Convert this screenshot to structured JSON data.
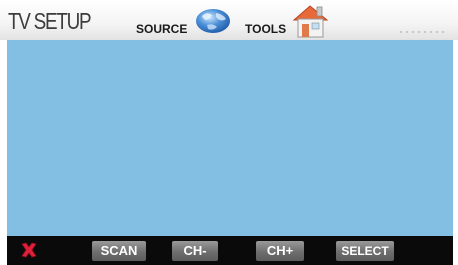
{
  "header": {
    "title": "TV SETUP",
    "source_label": "SOURCE",
    "tools_label": "TOOLS",
    "source_icon": "globe-icon",
    "tools_icon": "home-icon"
  },
  "display": {
    "background_color": "#82bfe2"
  },
  "bottom_bar": {
    "close_icon": "close-icon",
    "close_color": "#e0203a",
    "buttons": [
      {
        "label": "SCAN"
      },
      {
        "label": "CH-"
      },
      {
        "label": "CH+"
      },
      {
        "label": "SELECT"
      }
    ]
  }
}
